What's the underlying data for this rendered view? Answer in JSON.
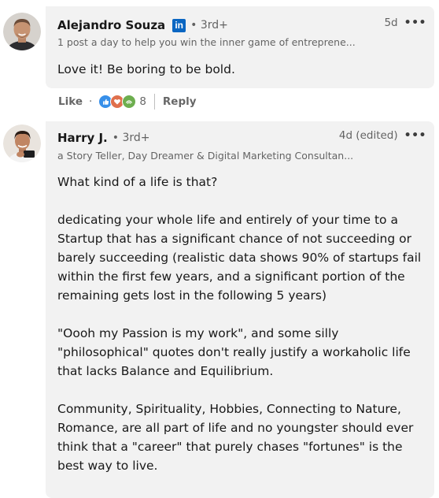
{
  "comments": [
    {
      "author": "Alejandro Souza",
      "linkedin_badge": "in",
      "degree": "• 3rd+",
      "headline": "1 post a day to help you win the inner game of entreprene...",
      "time": "5d",
      "more": "•••",
      "body": [
        "Love it! Be boring to be bold."
      ],
      "actions": {
        "like": "Like",
        "separator": "·",
        "reaction_count": "8",
        "reply": "Reply",
        "reaction_icons": [
          "like-reaction-icon",
          "love-reaction-icon",
          "support-reaction-icon"
        ]
      }
    },
    {
      "author": "Harry J.",
      "degree": "• 3rd+",
      "headline": "a Story Teller, Day Dreamer & Digital Marketing Consultan...",
      "time": "4d (edited)",
      "more": "•••",
      "body": [
        "What kind of a life is that?",
        "dedicating your whole life and entirely of your time to a Startup that has a significant chance of not succeeding or barely succeeding (realistic data shows 90% of startups fail within the first few years, and a significant portion of the remaining gets lost in the following 5 years)",
        "\"Oooh my Passion is my work\", and some silly \"philosophical\" quotes don't really justify a workaholic life that lacks Balance and Equilibrium.",
        "Community, Spirituality, Hobbies, Connecting to Nature, Romance, are all part of life and no youngster should ever think that a \"career\" that purely chases \"fortunes\" is the best way to live."
      ]
    }
  ],
  "colors": {
    "bubble_bg": "#f2f2f2",
    "linkedin_blue": "#0a66c2",
    "like_blue": "#378fe9",
    "love_red": "#df704d",
    "support_green": "#6dae4f",
    "muted_text": "rgba(0,0,0,0.6)"
  }
}
